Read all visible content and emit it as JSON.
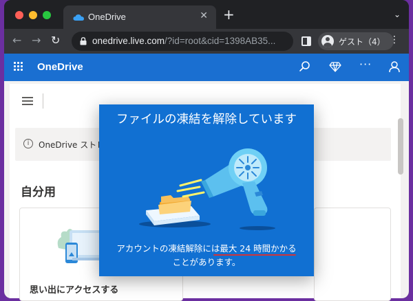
{
  "browser": {
    "tab_title": "OneDrive",
    "tab_close": "✕",
    "new_tab": "+",
    "tab_menu": "⌄",
    "nav_back": "←",
    "nav_forward": "→",
    "nav_reload": "↻",
    "url_host": "onedrive.live.com",
    "url_rest": "/?id=root&cid=1398AB35...",
    "profile_label": "ゲスト（4）",
    "menu": "⋮"
  },
  "app": {
    "name": "OneDrive",
    "more": "···",
    "notice_text": "OneDrive ストレー",
    "info_glyph": "i",
    "section_title": "自分用",
    "tile_label": "思い出にアクセスする"
  },
  "modal": {
    "title": "ファイルの凍結を解除しています",
    "body_line1_pre": "アカウントの凍結解除には",
    "body_line1_hl": "最大 24 時間かかる",
    "body_line2": "ことがあります。"
  },
  "colors": {
    "accent": "#1a6fd1",
    "modal_bg": "#1170d2",
    "underline": "#d13438"
  }
}
